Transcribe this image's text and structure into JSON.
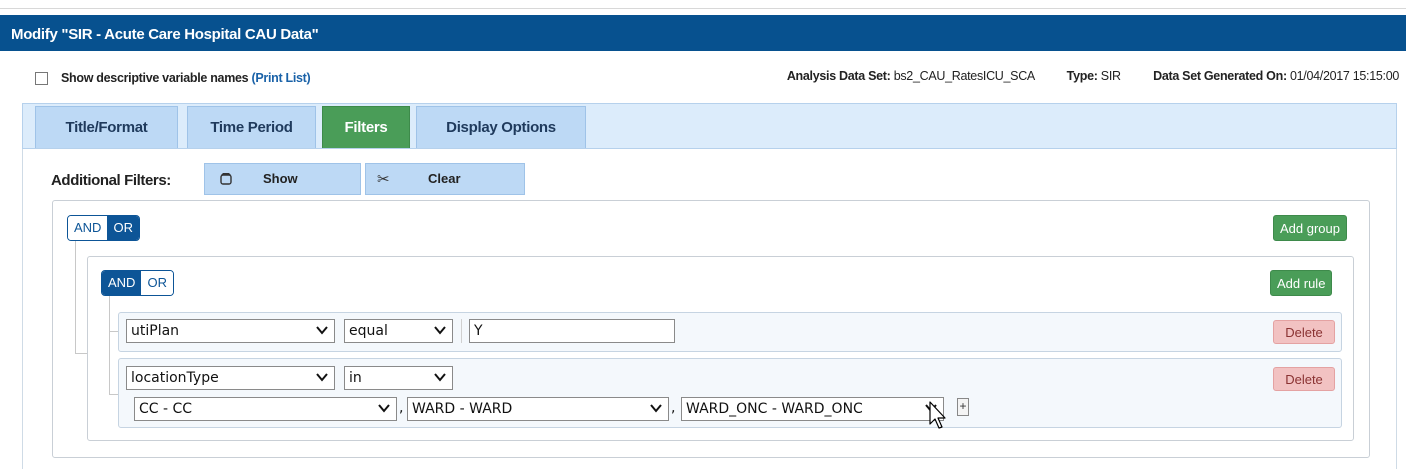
{
  "window": {
    "title": "Modify \"SIR - Acute Care Hospital CAU Data\""
  },
  "info": {
    "show_descriptive_label": "Show descriptive variable names",
    "print_list_link": "(Print List)",
    "analysis_label": "Analysis Data Set:",
    "analysis_value": "bs2_CAU_RatesICU_SCA",
    "type_label": "Type:",
    "type_value": "SIR",
    "generated_label": "Data Set Generated On:",
    "generated_value": "01/04/2017 15:15:00"
  },
  "tabs": [
    {
      "label": "Title/Format",
      "active": false
    },
    {
      "label": "Time Period",
      "active": false
    },
    {
      "label": "Filters",
      "active": true
    },
    {
      "label": "Display Options",
      "active": false
    }
  ],
  "filters": {
    "additional_label": "Additional Filters:",
    "show_label": "Show",
    "show_icon": "filter-toggle-icon",
    "clear_label": "Clear",
    "clear_icon": "scissors-icon",
    "outer_group": {
      "and_label": "AND",
      "or_label": "OR",
      "selected": "OR",
      "add_group_label": "Add group"
    },
    "inner_group": {
      "and_label": "AND",
      "or_label": "OR",
      "selected": "AND",
      "add_rule_label": "Add rule"
    },
    "rules": [
      {
        "field": "utiPlan",
        "operator": "equal",
        "value": "Y",
        "delete_label": "Delete"
      },
      {
        "field": "locationType",
        "operator": "in",
        "values": [
          "CC - CC",
          "WARD - WARD",
          "WARD_ONC - WARD_ONC"
        ],
        "separator": ",",
        "add_value_label": "+",
        "delete_label": "Delete"
      }
    ]
  },
  "colors": {
    "title_bar": "#07518f",
    "tab_active": "#4a9d58",
    "tab_inactive": "#bdd9f5",
    "toggle_selected": "#0d5597",
    "add_button": "#4a9d58",
    "delete_button": "#f2c2c2"
  }
}
